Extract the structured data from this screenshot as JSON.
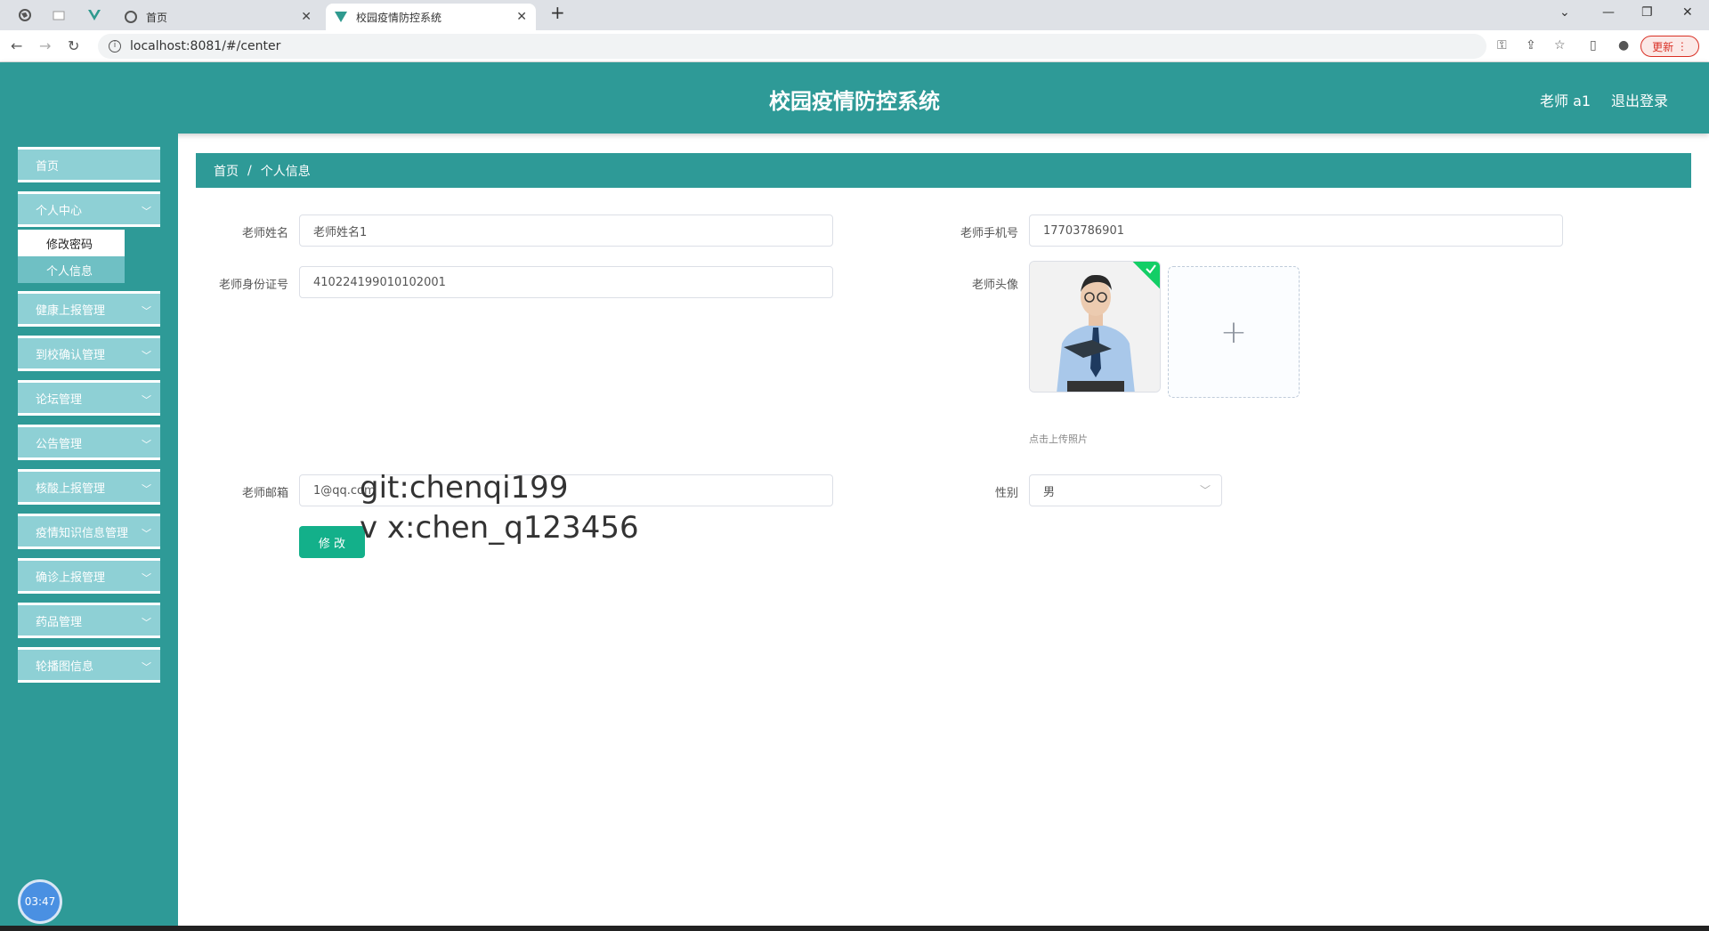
{
  "browser": {
    "tabs": [
      {
        "label": "首页"
      },
      {
        "label": "校园疫情防控系统"
      }
    ],
    "url": "localhost:8081/#/center",
    "update_label": "更新"
  },
  "header": {
    "title": "校园疫情防控系统",
    "user": "老师 a1",
    "logout": "退出登录"
  },
  "sidebar": {
    "items": [
      {
        "label": "首页"
      },
      {
        "label": "个人中心"
      },
      {
        "label": "健康上报管理"
      },
      {
        "label": "到校确认管理"
      },
      {
        "label": "论坛管理"
      },
      {
        "label": "公告管理"
      },
      {
        "label": "核酸上报管理"
      },
      {
        "label": "疫情知识信息管理"
      },
      {
        "label": "确诊上报管理"
      },
      {
        "label": "药品管理"
      },
      {
        "label": "轮播图信息"
      }
    ],
    "sub": [
      {
        "label": "修改密码"
      },
      {
        "label": "个人信息"
      }
    ],
    "clock": "03:47"
  },
  "breadcrumb": {
    "home": "首页",
    "sep": "/",
    "current": "个人信息"
  },
  "form": {
    "name_label": "老师姓名",
    "name_value": "老师姓名1",
    "phone_label": "老师手机号",
    "phone_value": "17703786901",
    "id_label": "老师身份证号",
    "id_value": "410224199010102001",
    "avatar_label": "老师头像",
    "upload_hint": "点击上传照片",
    "email_label": "老师邮箱",
    "email_value": "1@qq.com",
    "gender_label": "性别",
    "gender_value": "男",
    "submit": "修 改"
  },
  "watermark": {
    "line1": "git:chenqi199",
    "line2": "v x:chen_q123456"
  }
}
